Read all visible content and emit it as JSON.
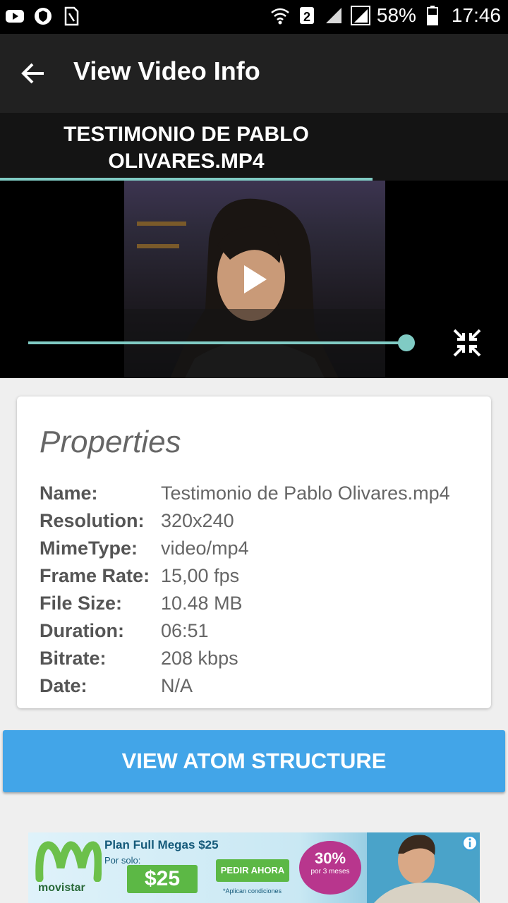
{
  "status_bar": {
    "sim_slot": "2",
    "battery": "58%",
    "time": "17:46"
  },
  "app_bar": {
    "title": "View Video Info"
  },
  "video": {
    "file_title": "TESTIMONIO DE PABLO OLIVARES.MP4",
    "progress": 1.0
  },
  "properties": {
    "title": "Properties",
    "rows": [
      {
        "label": "Name:",
        "value": "Testimonio de Pablo Olivares.mp4"
      },
      {
        "label": "Resolution:",
        "value": "320x240"
      },
      {
        "label": "MimeType:",
        "value": "video/mp4"
      },
      {
        "label": "Frame Rate:",
        "value": "15,00 fps"
      },
      {
        "label": "File Size:",
        "value": "10.48 MB"
      },
      {
        "label": "Duration:",
        "value": "06:51"
      },
      {
        "label": "Bitrate:",
        "value": "208 kbps"
      },
      {
        "label": "Date:",
        "value": "N/A"
      }
    ]
  },
  "buttons": {
    "atom_structure": "VIEW ATOM STRUCTURE"
  },
  "ad": {
    "brand": "movistar",
    "headline": "Plan Full Megas $25",
    "por_solo": "Por solo:",
    "price": "$25",
    "cta": "PEDIR AHORA",
    "note": "*Aplican condiciones",
    "badge": "30%",
    "badge_sub": "por 3 meses"
  },
  "colors": {
    "accent": "#80cbc4",
    "button": "#42a5e8",
    "app_bar": "#212121"
  }
}
